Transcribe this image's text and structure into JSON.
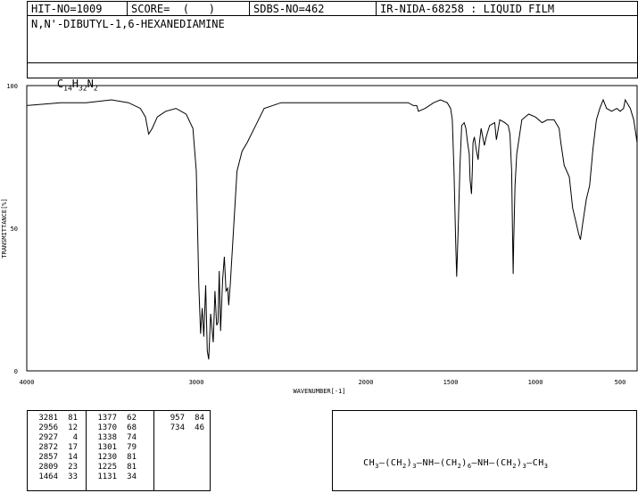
{
  "header": {
    "hit_no": "HIT-NO=1009",
    "score": "SCORE=  (   )",
    "sdbs_no": "SDBS-NO=462",
    "ir_info": "IR-NIDA-68258 : LIQUID FILM"
  },
  "compound": {
    "name": "N,N'-DIBUTYL-1,6-HEXANEDIAMINE",
    "formula_parts": [
      "C",
      "14",
      "H",
      "32",
      "N",
      "2"
    ]
  },
  "chart_data": {
    "type": "line",
    "xlabel": "WAVENUMBER[-1]",
    "ylabel": "TRANSMITTANCE[%]",
    "xlim": [
      4000,
      400
    ],
    "ylim": [
      0,
      100
    ],
    "x_ticks": [
      4000,
      3000,
      2000,
      1500,
      1000,
      500
    ],
    "y_ticks": [
      0,
      50,
      100
    ],
    "series": [
      {
        "x": [
          4000,
          3800,
          3650,
          3500,
          3400,
          3330,
          3300,
          3281,
          3260,
          3230,
          3180,
          3120,
          3060,
          3020,
          3000,
          2985,
          2975,
          2965,
          2956,
          2945,
          2935,
          2927,
          2915,
          2900,
          2890,
          2880,
          2872,
          2865,
          2857,
          2845,
          2835,
          2825,
          2815,
          2809,
          2800,
          2780,
          2760,
          2730,
          2700,
          2650,
          2600,
          2500,
          2400,
          2300,
          2200,
          2100,
          2000,
          1900,
          1800,
          1750,
          1720,
          1700,
          1690,
          1650,
          1600,
          1560,
          1520,
          1500,
          1490,
          1480,
          1470,
          1464,
          1455,
          1445,
          1435,
          1420,
          1410,
          1400,
          1390,
          1385,
          1377,
          1372,
          1368,
          1360,
          1350,
          1338,
          1330,
          1320,
          1301,
          1290,
          1270,
          1240,
          1230,
          1210,
          1180,
          1160,
          1150,
          1140,
          1135,
          1131,
          1128,
          1120,
          1110,
          1100,
          1080,
          1060,
          1040,
          1000,
          960,
          930,
          890,
          870,
          860,
          850,
          830,
          800,
          780,
          760,
          745,
          734,
          720,
          700,
          680,
          660,
          640,
          620,
          600,
          580,
          550,
          520,
          500,
          480,
          470,
          460,
          440,
          420,
          410,
          400
        ],
        "y": [
          93,
          94,
          94,
          95,
          94,
          92,
          89,
          83,
          85,
          89,
          91,
          92,
          90,
          85,
          70,
          30,
          13,
          22,
          12,
          30,
          7,
          4,
          20,
          10,
          28,
          16,
          17,
          35,
          14,
          32,
          40,
          28,
          29,
          23,
          30,
          50,
          70,
          77,
          80,
          86,
          92,
          94,
          94,
          94,
          94,
          94,
          94,
          94,
          94,
          94,
          93,
          93,
          91,
          92,
          94,
          95,
          94,
          92,
          88,
          70,
          45,
          33,
          50,
          72,
          86,
          87,
          85,
          80,
          76,
          67,
          62,
          70,
          80,
          82,
          78,
          74,
          80,
          85,
          79,
          82,
          86,
          87,
          81,
          88,
          87,
          86,
          83,
          70,
          50,
          34,
          45,
          65,
          76,
          80,
          88,
          89,
          90,
          89,
          87,
          88,
          88,
          86,
          85,
          80,
          72,
          68,
          57,
          52,
          48,
          46,
          52,
          60,
          65,
          78,
          88,
          92,
          95,
          92,
          91,
          92,
          91,
          92,
          95,
          94,
          92,
          88,
          84,
          80
        ]
      }
    ],
    "peak_table": [
      [
        "3281",
        "81"
      ],
      [
        "2956",
        "12"
      ],
      [
        "2927",
        "4"
      ],
      [
        "2872",
        "17"
      ],
      [
        "2857",
        "14"
      ],
      [
        "2809",
        "23"
      ],
      [
        "1464",
        "33"
      ],
      [
        "1377",
        "62"
      ],
      [
        "1370",
        "68"
      ],
      [
        "1338",
        "74"
      ],
      [
        "1301",
        "79"
      ],
      [
        "1230",
        "81"
      ],
      [
        "1225",
        "81"
      ],
      [
        "1131",
        "34"
      ],
      [
        "957",
        "84"
      ],
      [
        "734",
        "46"
      ]
    ]
  },
  "structure": {
    "parts": [
      "CH",
      "3",
      "—(CH",
      "2",
      ")",
      "3",
      "—NH—(CH",
      "2",
      ")",
      "6",
      "—NH—(CH",
      "2",
      ")",
      "3",
      "—CH",
      "3"
    ]
  }
}
